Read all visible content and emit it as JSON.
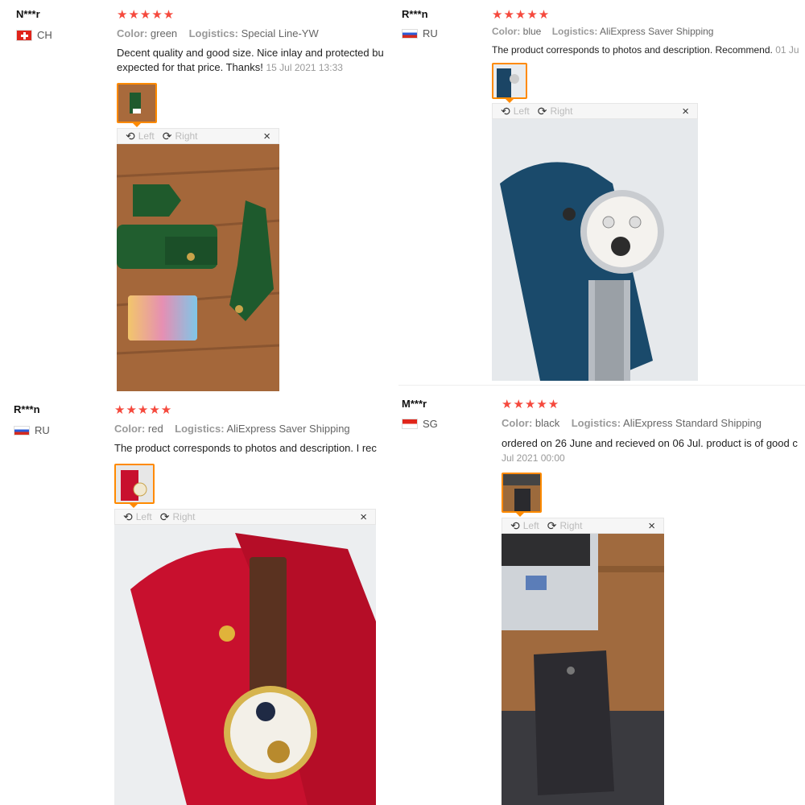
{
  "reviews": [
    {
      "user": "N***r",
      "country": "CH",
      "stars": "★★★★★",
      "color_label": "Color:",
      "color": "green",
      "logistics_label": "Logistics:",
      "logistics": "Special Line-YW",
      "text": "Decent quality and good size. Nice inlay and protected bu expected for that price. Thanks!",
      "date": "15 Jul 2021 13:33",
      "viewer": {
        "left": "Left",
        "right": "Right",
        "close": "×"
      }
    },
    {
      "user": "R***n",
      "country": "RU",
      "stars": "★★★★★",
      "color_label": "Color:",
      "color": "blue",
      "logistics_label": "Logistics:",
      "logistics": "AliExpress Saver Shipping",
      "text": "The product corresponds to photos and description. Recommend.",
      "date": "01 Ju",
      "viewer": {
        "left": "Left",
        "right": "Right",
        "close": "×"
      }
    },
    {
      "user": "R***n",
      "country": "RU",
      "stars": "★★★★★",
      "color_label": "Color:",
      "color": "red",
      "logistics_label": "Logistics:",
      "logistics": "AliExpress Saver Shipping",
      "text": "The product corresponds to photos and description. I rec",
      "date": "",
      "viewer": {
        "left": "Left",
        "right": "Right",
        "close": "×"
      }
    },
    {
      "user": "M***r",
      "country": "SG",
      "stars": "★★★★★",
      "color_label": "Color:",
      "color": "black",
      "logistics_label": "Logistics:",
      "logistics": "AliExpress Standard Shipping",
      "text": "ordered on 26 June and recieved on 06 Jul. product is of good c",
      "date": "Jul 2021 00:00",
      "viewer": {
        "left": "Left",
        "right": "Right",
        "close": "×"
      }
    }
  ],
  "colors": {
    "star": "#f5493d",
    "accent": "#ff8a00"
  }
}
